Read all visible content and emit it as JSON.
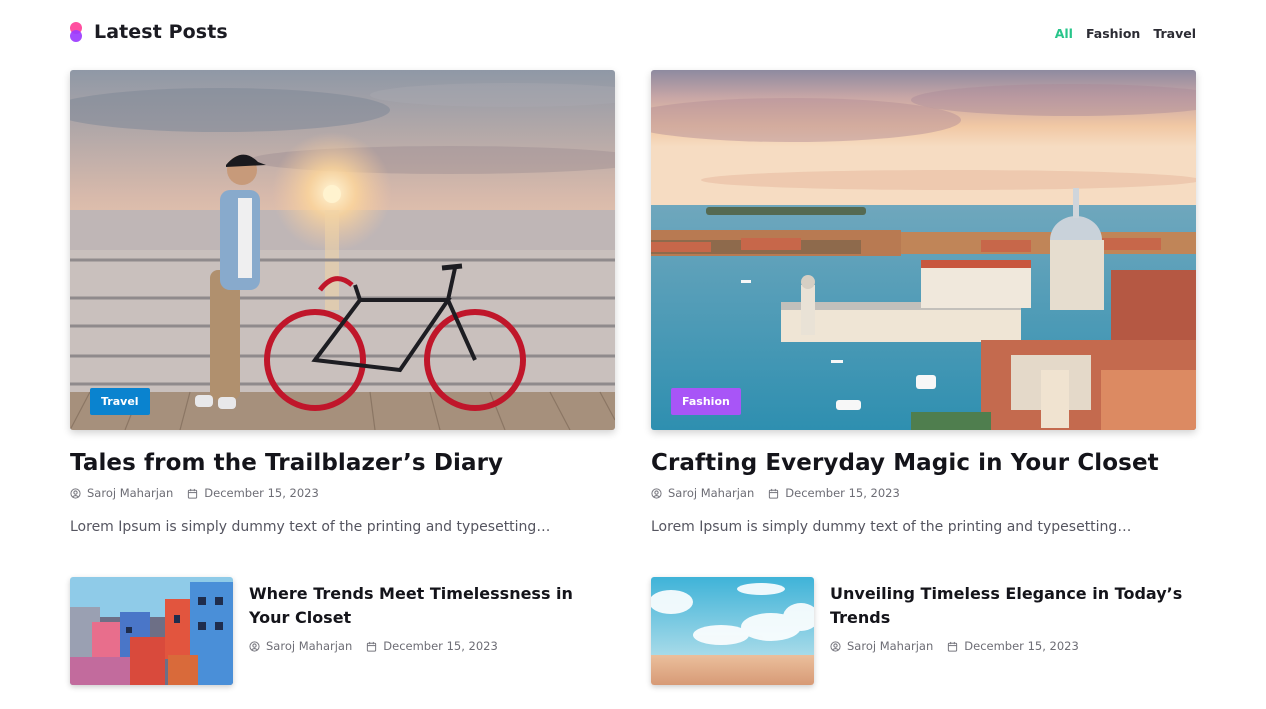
{
  "header": {
    "title": "Latest Posts",
    "filters": [
      "All",
      "Fashion",
      "Travel"
    ],
    "active_filter": "All"
  },
  "featured": [
    {
      "category": "Travel",
      "title": "Tales from the Trailblazer’s Diary",
      "author": "Saroj Maharjan",
      "date": "December 15, 2023",
      "excerpt": "Lorem Ipsum is simply dummy text of the printing and typesetting…"
    },
    {
      "category": "Fashion",
      "title": "Crafting Everyday Magic in Your Closet",
      "author": "Saroj Maharjan",
      "date": "December 15, 2023",
      "excerpt": "Lorem Ipsum is simply dummy text of the printing and typesetting…"
    }
  ],
  "small_posts": [
    {
      "title": "Where Trends Meet Timelessness in Your Closet",
      "author": "Saroj Maharjan",
      "date": "December 15, 2023"
    },
    {
      "title": "Unveiling Timeless Elegance in Today’s Trends",
      "author": "Saroj Maharjan",
      "date": "December 15, 2023"
    }
  ],
  "colors": {
    "accent": "#27c58a",
    "travel_badge": "#0a83cf",
    "fashion_badge": "#a855f7"
  },
  "icons": {
    "author": "user-circle-icon",
    "date": "calendar-icon"
  }
}
